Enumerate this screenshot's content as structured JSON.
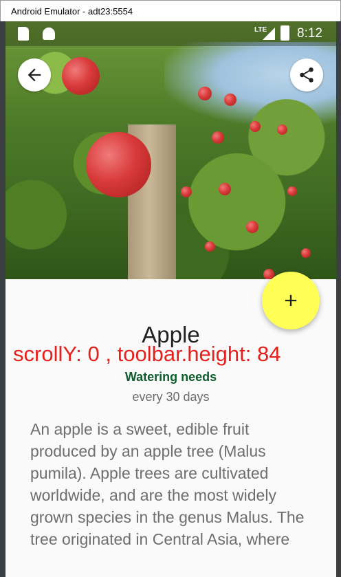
{
  "window": {
    "title": "Android Emulator - adt23:5554"
  },
  "status_bar": {
    "time": "8:12",
    "network": "LTE",
    "icons": [
      "sd-card-icon",
      "android-icon",
      "signal-icon",
      "battery-charging-icon"
    ]
  },
  "toolbar": {
    "back_icon": "arrow-back-icon",
    "share_icon": "share-icon"
  },
  "fab": {
    "icon": "plus-icon"
  },
  "plant": {
    "name": "Apple",
    "watering_label": "Watering needs",
    "watering_interval": "every 30 days",
    "description": "An apple is a sweet, edible fruit produced by an apple tree (Malus pumila). Apple trees are cultivated worldwide, and are the most widely grown species in the genus Malus. The tree originated in Central Asia, where"
  },
  "debug": {
    "text": "scrollY: 0 , toolbar.height: 84"
  },
  "colors": {
    "fab": "#ffff55",
    "debug_text": "#e5211d",
    "watering_label": "#0d5e2c"
  }
}
